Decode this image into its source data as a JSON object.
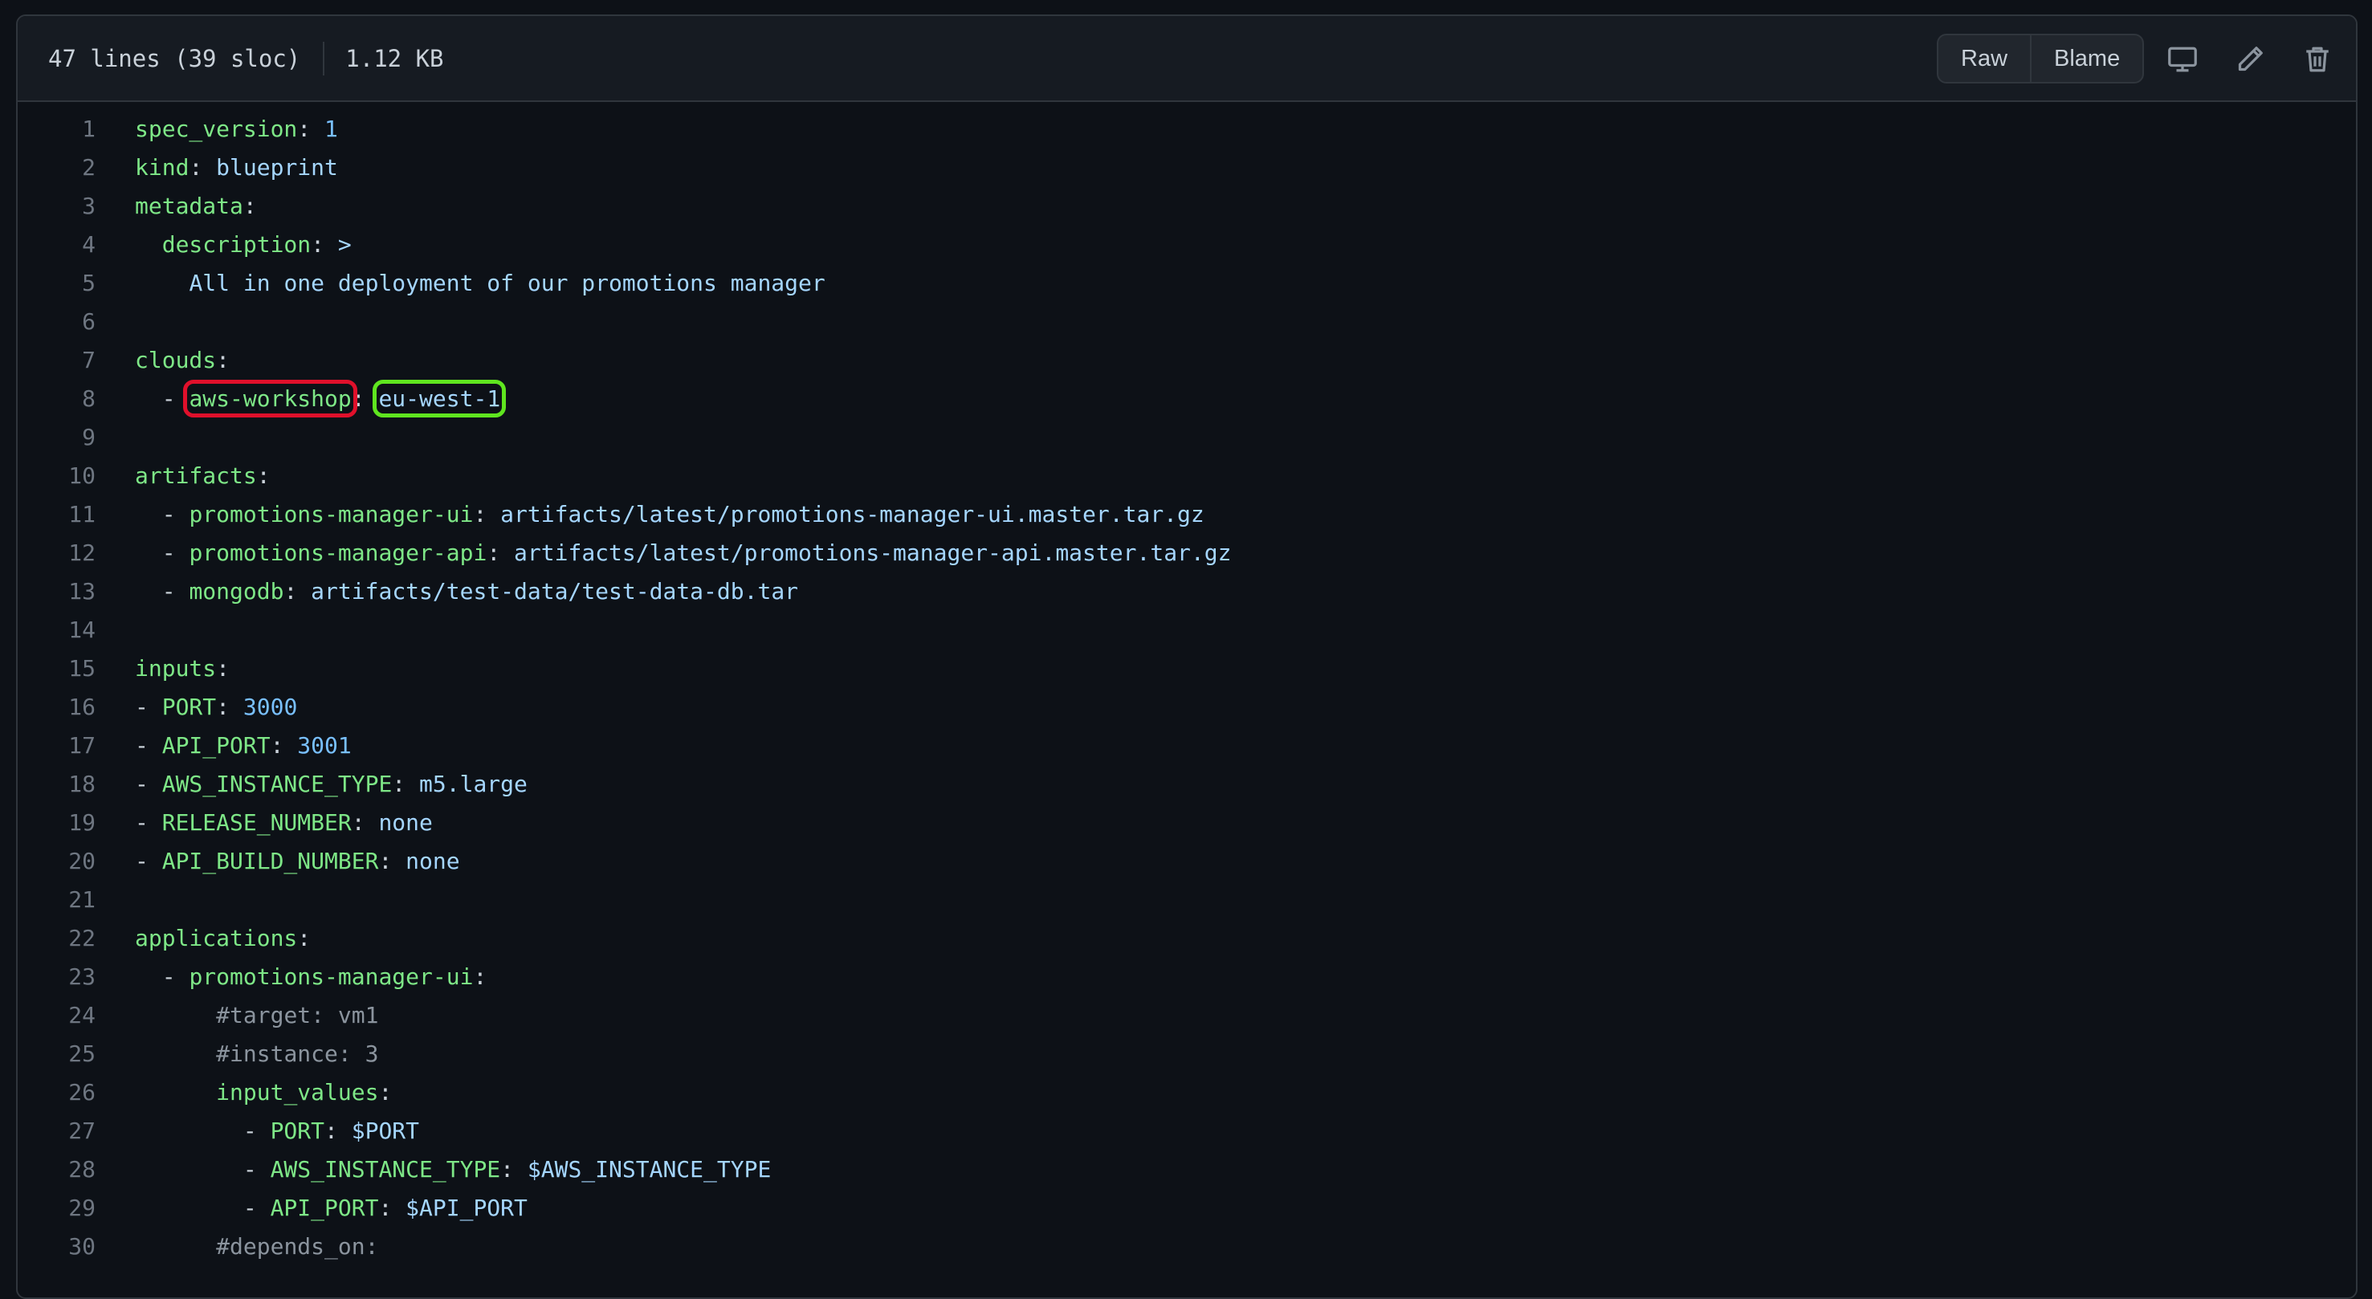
{
  "header": {
    "line_info": "47 lines (39 sloc)",
    "size": "1.12 KB",
    "raw_label": "Raw",
    "blame_label": "Blame",
    "display_icon": "desktop-icon",
    "edit_icon": "pencil-icon",
    "delete_icon": "trash-icon"
  },
  "colors": {
    "key": "#7ee787",
    "string": "#a5d6ff",
    "number": "#79c0ff",
    "comment": "#8b949e",
    "highlight_red": "#e0102b",
    "highlight_green": "#5fe51f"
  },
  "code": {
    "lines": [
      {
        "num": "1",
        "indent": "",
        "key": "spec_version",
        "sep": ": ",
        "value": "1",
        "vtype": "n"
      },
      {
        "num": "2",
        "indent": "",
        "key": "kind",
        "sep": ": ",
        "value": "blueprint",
        "vtype": "v"
      },
      {
        "num": "3",
        "indent": "",
        "key": "metadata",
        "sep": ":",
        "value": "",
        "vtype": "v"
      },
      {
        "num": "4",
        "indent": "  ",
        "key": "description",
        "sep": ": ",
        "value": ">",
        "vtype": "v"
      },
      {
        "num": "5",
        "indent": "    ",
        "key": "",
        "sep": "",
        "value": "All in one deployment of our promotions manager",
        "vtype": "v"
      },
      {
        "num": "6",
        "indent": "",
        "key": "",
        "sep": "",
        "value": "",
        "vtype": "v"
      },
      {
        "num": "7",
        "indent": "",
        "key": "clouds",
        "sep": ":",
        "value": "",
        "vtype": "v"
      },
      {
        "num": "8",
        "indent": "  - ",
        "key": "aws-workshop",
        "sep": ": ",
        "value": "eu-west-1",
        "vtype": "v",
        "hl": true
      },
      {
        "num": "9",
        "indent": "",
        "key": "",
        "sep": "",
        "value": "",
        "vtype": "v"
      },
      {
        "num": "10",
        "indent": "",
        "key": "artifacts",
        "sep": ":",
        "value": "",
        "vtype": "v"
      },
      {
        "num": "11",
        "indent": "  - ",
        "key": "promotions-manager-ui",
        "sep": ": ",
        "value": "artifacts/latest/promotions-manager-ui.master.tar.gz",
        "vtype": "v"
      },
      {
        "num": "12",
        "indent": "  - ",
        "key": "promotions-manager-api",
        "sep": ": ",
        "value": "artifacts/latest/promotions-manager-api.master.tar.gz",
        "vtype": "v"
      },
      {
        "num": "13",
        "indent": "  - ",
        "key": "mongodb",
        "sep": ": ",
        "value": "artifacts/test-data/test-data-db.tar",
        "vtype": "v"
      },
      {
        "num": "14",
        "indent": "",
        "key": "",
        "sep": "",
        "value": "",
        "vtype": "v"
      },
      {
        "num": "15",
        "indent": "",
        "key": "inputs",
        "sep": ":",
        "value": "",
        "vtype": "v"
      },
      {
        "num": "16",
        "indent": "- ",
        "key": "PORT",
        "sep": ": ",
        "value": "3000",
        "vtype": "n"
      },
      {
        "num": "17",
        "indent": "- ",
        "key": "API_PORT",
        "sep": ": ",
        "value": "3001",
        "vtype": "n"
      },
      {
        "num": "18",
        "indent": "- ",
        "key": "AWS_INSTANCE_TYPE",
        "sep": ": ",
        "value": "m5.large",
        "vtype": "v"
      },
      {
        "num": "19",
        "indent": "- ",
        "key": "RELEASE_NUMBER",
        "sep": ": ",
        "value": "none",
        "vtype": "v"
      },
      {
        "num": "20",
        "indent": "- ",
        "key": "API_BUILD_NUMBER",
        "sep": ": ",
        "value": "none",
        "vtype": "v"
      },
      {
        "num": "21",
        "indent": "",
        "key": "",
        "sep": "",
        "value": "",
        "vtype": "v"
      },
      {
        "num": "22",
        "indent": "",
        "key": "applications",
        "sep": ":",
        "value": "",
        "vtype": "v"
      },
      {
        "num": "23",
        "indent": "  - ",
        "key": "promotions-manager-ui",
        "sep": ":",
        "value": "",
        "vtype": "v"
      },
      {
        "num": "24",
        "indent": "      ",
        "key": "",
        "sep": "",
        "value": "#target: vm1",
        "vtype": "c"
      },
      {
        "num": "25",
        "indent": "      ",
        "key": "",
        "sep": "",
        "value": "#instance: 3",
        "vtype": "c"
      },
      {
        "num": "26",
        "indent": "      ",
        "key": "input_values",
        "sep": ":",
        "value": "",
        "vtype": "v"
      },
      {
        "num": "27",
        "indent": "        - ",
        "key": "PORT",
        "sep": ": ",
        "value": "$PORT",
        "vtype": "v"
      },
      {
        "num": "28",
        "indent": "        - ",
        "key": "AWS_INSTANCE_TYPE",
        "sep": ": ",
        "value": "$AWS_INSTANCE_TYPE",
        "vtype": "v"
      },
      {
        "num": "29",
        "indent": "        - ",
        "key": "API_PORT",
        "sep": ": ",
        "value": "$API_PORT",
        "vtype": "v"
      },
      {
        "num": "30",
        "indent": "      ",
        "key": "",
        "sep": "",
        "value": "#depends_on:",
        "vtype": "c"
      }
    ]
  }
}
